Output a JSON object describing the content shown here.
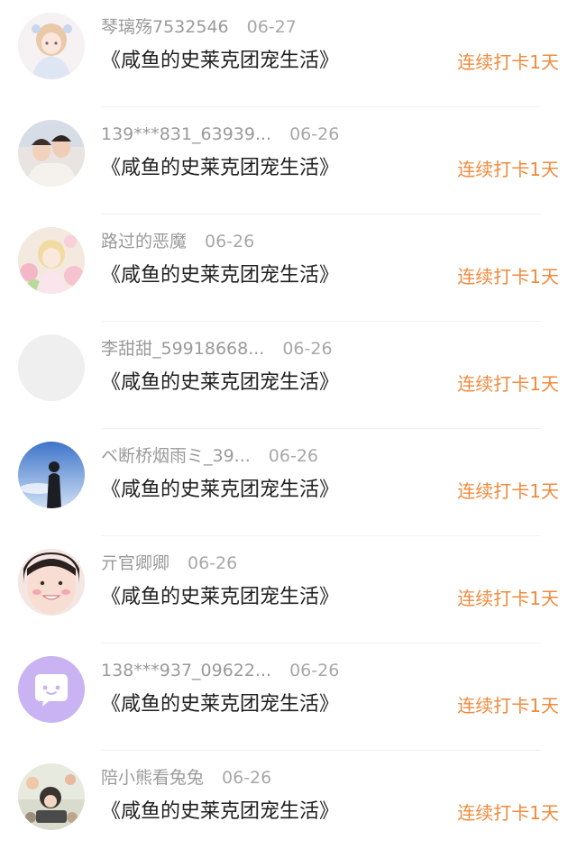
{
  "colors": {
    "streak": "#f08a3c",
    "username": "#9a9a9a",
    "date": "#a8a8a8",
    "title": "#1f1f1f",
    "divider": "#f1f1f1"
  },
  "entries": [
    {
      "username": "琴璃殇7532546",
      "date": "06-27",
      "book": "《咸鱼的史莱克团宠生活》",
      "streak": "连续打卡1天",
      "avatar": "anime-girl-avatar"
    },
    {
      "username": "139***831_63939...",
      "date": "06-26",
      "book": "《咸鱼的史莱克团宠生活》",
      "streak": "连续打卡1天",
      "avatar": "couple-photo-avatar"
    },
    {
      "username": "路过的恶魔",
      "date": "06-26",
      "book": "《咸鱼的史莱克团宠生活》",
      "streak": "连续打卡1天",
      "avatar": "floral-anime-avatar"
    },
    {
      "username": "李甜甜_59918668...",
      "date": "06-26",
      "book": "《咸鱼的史莱克团宠生活》",
      "streak": "连续打卡1天",
      "avatar": "default-gray-avatar"
    },
    {
      "username": "ベ断桥烟雨ミ_39...",
      "date": "06-26",
      "book": "《咸鱼的史莱克团宠生活》",
      "streak": "连续打卡1天",
      "avatar": "sky-silhouette-avatar"
    },
    {
      "username": "亓官卿卿",
      "date": "06-26",
      "book": "《咸鱼的史莱克团宠生活》",
      "streak": "连续打卡1天",
      "avatar": "smiling-face-avatar"
    },
    {
      "username": "138***937_09622...",
      "date": "06-26",
      "book": "《咸鱼的史莱克团宠生活》",
      "streak": "连续打卡1天",
      "avatar": "purple-chat-avatar"
    },
    {
      "username": "陪小熊看兔兔",
      "date": "06-26",
      "book": "《咸鱼的史莱克团宠生活》",
      "streak": "连续打卡1天",
      "avatar": "cartoon-scene-avatar"
    }
  ]
}
